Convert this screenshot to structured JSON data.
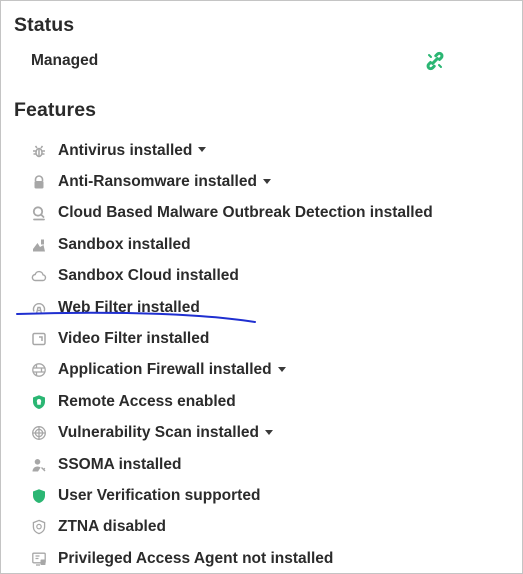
{
  "status": {
    "title": "Status",
    "managed_label": "Managed",
    "managed_icon": "link-connected-icon",
    "managed_icon_color": "#2bb673"
  },
  "features": {
    "title": "Features",
    "items": [
      {
        "label": "Antivirus installed",
        "icon": "bug-icon",
        "dropdown": true
      },
      {
        "label": "Anti-Ransomware installed",
        "icon": "lock-icon",
        "dropdown": true
      },
      {
        "label": "Cloud Based Malware Outbreak Detection installed",
        "icon": "magnifier-icon",
        "dropdown": false
      },
      {
        "label": "Sandbox installed",
        "icon": "sandbox-icon",
        "dropdown": false
      },
      {
        "label": "Sandbox Cloud installed",
        "icon": "cloud-icon",
        "dropdown": false
      },
      {
        "label": "Web Filter installed",
        "icon": "web-filter-icon",
        "dropdown": false
      },
      {
        "label": "Video Filter installed",
        "icon": "video-filter-icon",
        "dropdown": false
      },
      {
        "label": "Application Firewall installed",
        "icon": "firewall-icon",
        "dropdown": true
      },
      {
        "label": "Remote Access enabled",
        "icon": "shield-lock-icon",
        "dropdown": false
      },
      {
        "label": "Vulnerability Scan installed",
        "icon": "radar-icon",
        "dropdown": true
      },
      {
        "label": "SSOMA installed",
        "icon": "user-key-icon",
        "dropdown": false
      },
      {
        "label": "User Verification supported",
        "icon": "shield-icon",
        "dropdown": false
      },
      {
        "label": "ZTNA disabled",
        "icon": "ztna-shield-icon",
        "dropdown": false
      },
      {
        "label": "Privileged Access Agent not installed",
        "icon": "privileged-access-icon",
        "dropdown": false
      }
    ]
  },
  "colors": {
    "accent_green": "#2bb673",
    "icon_gray": "#a7a7a7",
    "annotation_blue": "#1f2fd0"
  }
}
